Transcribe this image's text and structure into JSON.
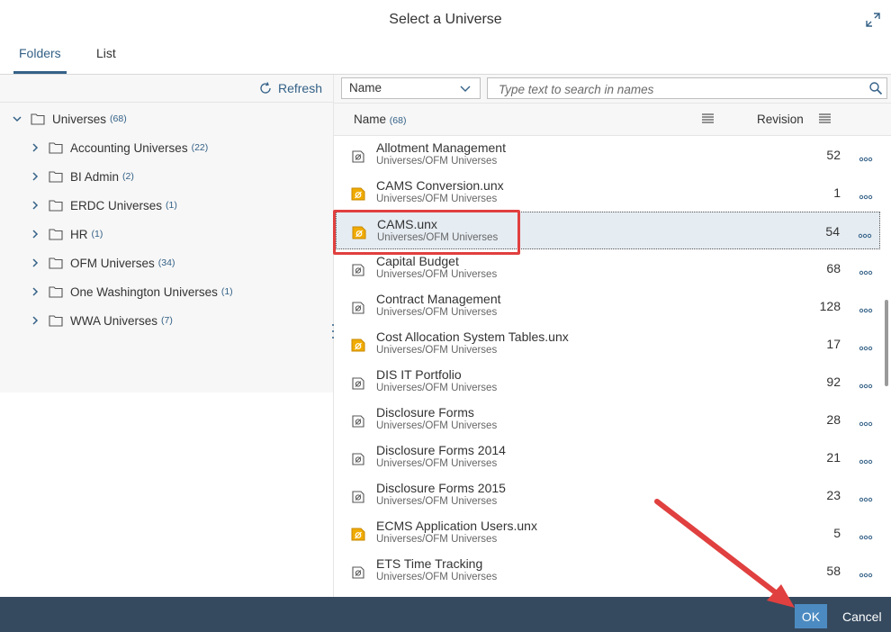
{
  "dialog": {
    "title": "Select a Universe"
  },
  "tabs": [
    {
      "label": "Folders",
      "active": true
    },
    {
      "label": "List",
      "active": false
    }
  ],
  "left": {
    "refresh_label": "Refresh",
    "root": {
      "label": "Universes",
      "count": "(68)"
    },
    "folders": [
      {
        "label": "Accounting Universes",
        "count": "(22)"
      },
      {
        "label": "BI Admin",
        "count": "(2)"
      },
      {
        "label": "ERDC Universes",
        "count": "(1)"
      },
      {
        "label": "HR",
        "count": "(1)"
      },
      {
        "label": "OFM Universes",
        "count": "(34)"
      },
      {
        "label": "One Washington Universes",
        "count": "(1)"
      },
      {
        "label": "WWA Universes",
        "count": "(7)"
      }
    ]
  },
  "right": {
    "filter_select": "Name",
    "search_placeholder": "Type text to search in names",
    "columns": {
      "name": "Name",
      "name_count": "(68)",
      "revision": "Revision"
    },
    "items": [
      {
        "name": "Allotment Management",
        "path": "Universes/OFM Universes",
        "revision": "52",
        "type": "unv"
      },
      {
        "name": "CAMS Conversion.unx",
        "path": "Universes/OFM Universes",
        "revision": "1",
        "type": "unx"
      },
      {
        "name": "CAMS.unx",
        "path": "Universes/OFM Universes",
        "revision": "54",
        "type": "unx",
        "selected": true
      },
      {
        "name": "Capital Budget",
        "path": "Universes/OFM Universes",
        "revision": "68",
        "type": "unv"
      },
      {
        "name": "Contract Management",
        "path": "Universes/OFM Universes",
        "revision": "128",
        "type": "unv"
      },
      {
        "name": "Cost Allocation System Tables.unx",
        "path": "Universes/OFM Universes",
        "revision": "17",
        "type": "unx"
      },
      {
        "name": "DIS IT Portfolio",
        "path": "Universes/OFM Universes",
        "revision": "92",
        "type": "unv"
      },
      {
        "name": "Disclosure Forms",
        "path": "Universes/OFM Universes",
        "revision": "28",
        "type": "unv"
      },
      {
        "name": "Disclosure Forms 2014",
        "path": "Universes/OFM Universes",
        "revision": "21",
        "type": "unv"
      },
      {
        "name": "Disclosure Forms 2015",
        "path": "Universes/OFM Universes",
        "revision": "23",
        "type": "unv"
      },
      {
        "name": "ECMS Application Users.unx",
        "path": "Universes/OFM Universes",
        "revision": "5",
        "type": "unx"
      },
      {
        "name": "ETS Time Tracking",
        "path": "Universes/OFM Universes",
        "revision": "58",
        "type": "unv"
      }
    ]
  },
  "footer": {
    "ok_label": "OK",
    "cancel_label": "Cancel"
  },
  "colors": {
    "accent": "#346187",
    "footer_bg": "#354a5f",
    "ok_bg": "#4c8bc1",
    "annotation_red": "#e0403f",
    "unx_icon": "#f0ab00"
  }
}
